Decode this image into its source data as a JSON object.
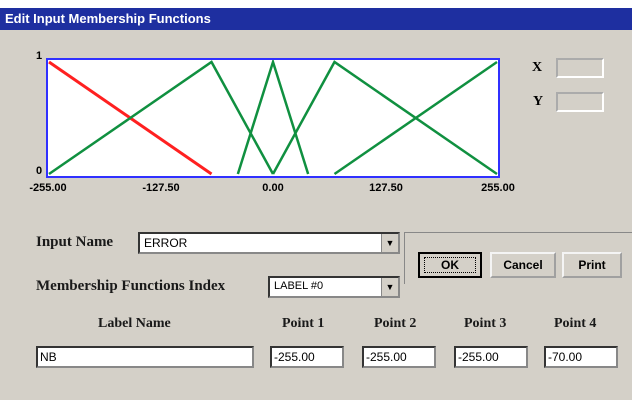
{
  "window": {
    "title": "Edit Input Membership Functions"
  },
  "chart_data": {
    "type": "line",
    "xlim": [
      -255,
      255
    ],
    "ylim": [
      0,
      1
    ],
    "x_ticks": [
      "-255.00",
      "-127.50",
      "0.00",
      "127.50",
      "255.00"
    ],
    "y_ticks": [
      "1",
      "0"
    ],
    "series": [
      {
        "color": "#ff2020",
        "points": [
          [
            -255,
            1
          ],
          [
            -70,
            0
          ]
        ]
      },
      {
        "color": "#109040",
        "points": [
          [
            -255,
            0
          ],
          [
            -70,
            1
          ],
          [
            0,
            0
          ]
        ]
      },
      {
        "color": "#109040",
        "points": [
          [
            -40,
            0
          ],
          [
            0,
            1
          ],
          [
            40,
            0
          ]
        ]
      },
      {
        "color": "#109040",
        "points": [
          [
            0,
            0
          ],
          [
            70,
            1
          ],
          [
            255,
            0
          ]
        ]
      },
      {
        "color": "#109040",
        "points": [
          [
            70,
            0
          ],
          [
            255,
            1
          ]
        ]
      }
    ]
  },
  "coords": {
    "x_label": "X",
    "y_label": "Y"
  },
  "form": {
    "input_name_label": "Input Name",
    "input_name_value": "ERROR",
    "mf_index_label": "Membership Functions Index",
    "mf_index_value": "LABEL #0",
    "label_name_header": "Label Name",
    "point1_header": "Point 1",
    "point2_header": "Point 2",
    "point3_header": "Point 3",
    "point4_header": "Point 4",
    "label_name_value": "NB",
    "point1_value": "-255.00",
    "point2_value": "-255.00",
    "point3_value": "-255.00",
    "point4_value": "-70.00"
  },
  "buttons": {
    "ok": "OK",
    "cancel": "Cancel",
    "print": "Print"
  }
}
